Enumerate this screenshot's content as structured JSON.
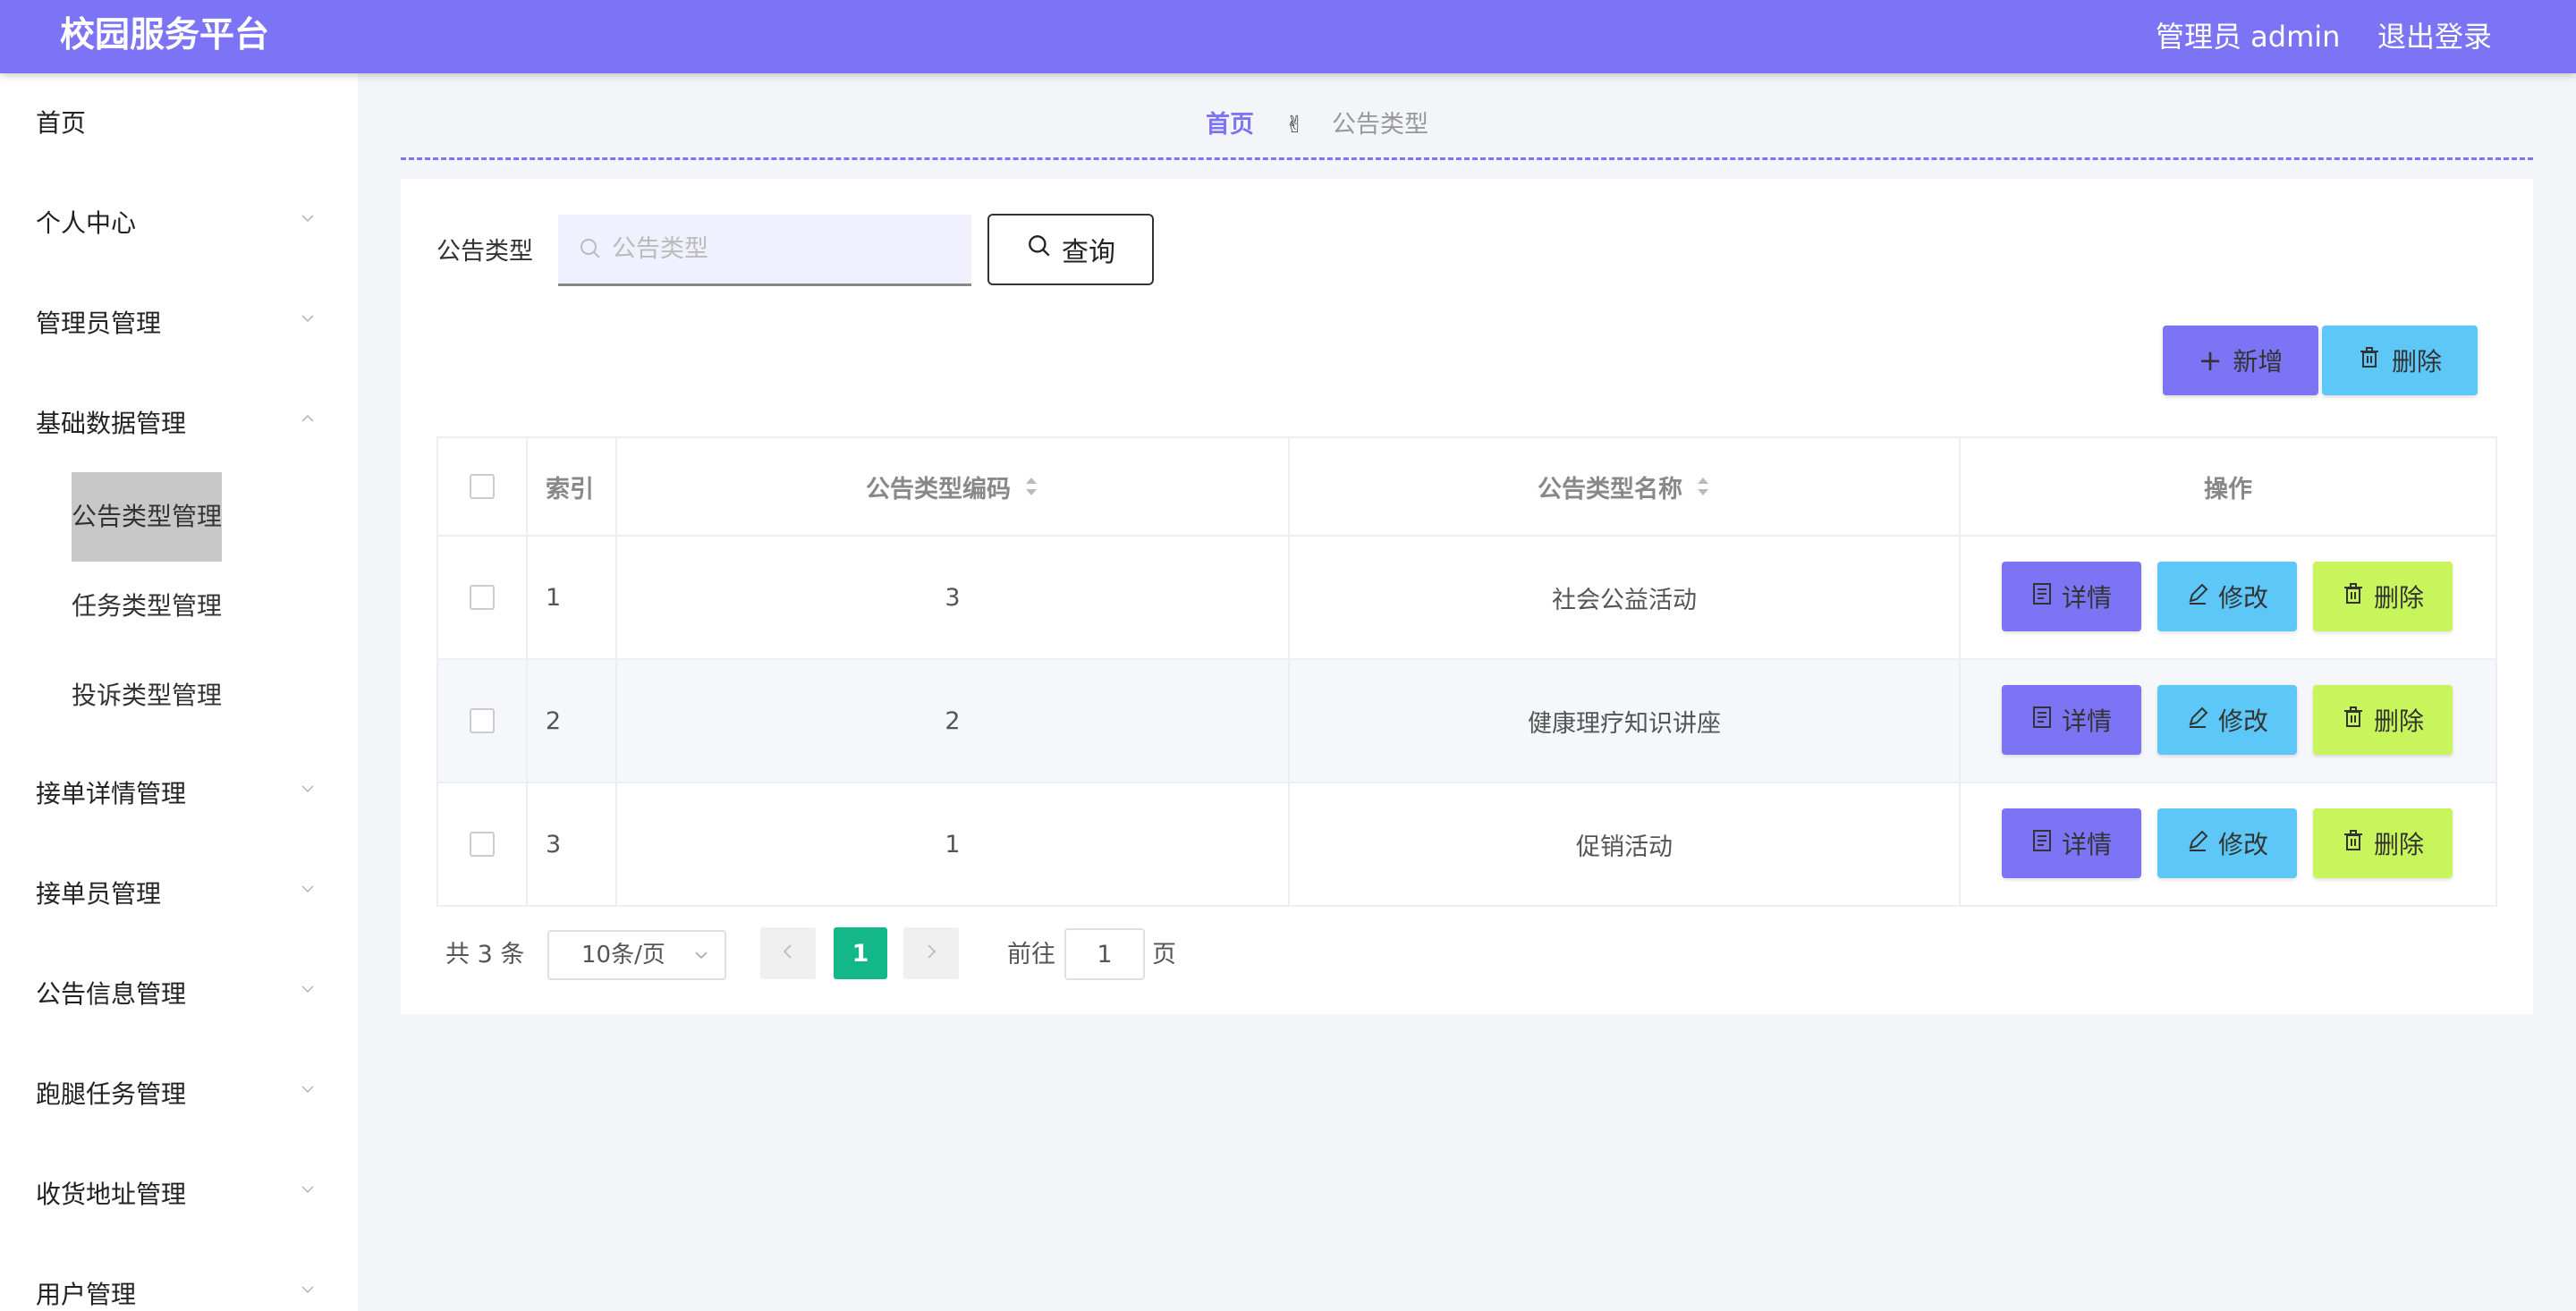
{
  "header": {
    "title": "校园服务平台",
    "user_label": "管理员 admin",
    "logout_label": "退出登录",
    "accent_color": "#7c74f4"
  },
  "sidebar": {
    "items": [
      {
        "label": "首页",
        "has_children": false
      },
      {
        "label": "个人中心",
        "has_children": true
      },
      {
        "label": "管理员管理",
        "has_children": true
      },
      {
        "label": "基础数据管理",
        "has_children": true,
        "expanded": true,
        "children": [
          {
            "label": "公告类型管理",
            "active": true
          },
          {
            "label": "任务类型管理"
          },
          {
            "label": "投诉类型管理"
          }
        ]
      },
      {
        "label": "接单详情管理",
        "has_children": true
      },
      {
        "label": "接单员管理",
        "has_children": true
      },
      {
        "label": "公告信息管理",
        "has_children": true
      },
      {
        "label": "跑腿任务管理",
        "has_children": true
      },
      {
        "label": "收货地址管理",
        "has_children": true
      },
      {
        "label": "用户管理",
        "has_children": true
      }
    ]
  },
  "breadcrumb": {
    "home": "首页",
    "separator_icon": "victory-hand-icon",
    "current": "公告类型"
  },
  "search": {
    "label": "公告类型",
    "placeholder": "公告类型",
    "value": "",
    "button_label": "查询"
  },
  "actions": {
    "add_label": "新增",
    "delete_label": "删除"
  },
  "table": {
    "columns": [
      "索引",
      "公告类型编码",
      "公告类型名称",
      "操作"
    ],
    "rows": [
      {
        "index": "1",
        "code": "3",
        "name": "社会公益活动"
      },
      {
        "index": "2",
        "code": "2",
        "name": "健康理疗知识讲座"
      },
      {
        "index": "3",
        "code": "1",
        "name": "促销活动"
      }
    ],
    "row_actions": {
      "detail": "详情",
      "edit": "修改",
      "delete": "删除"
    }
  },
  "pagination": {
    "total_text": "共 3 条",
    "page_size": "10条/页",
    "current_page": "1",
    "goto_label": "前往",
    "goto_value": "1",
    "page_suffix": "页"
  }
}
